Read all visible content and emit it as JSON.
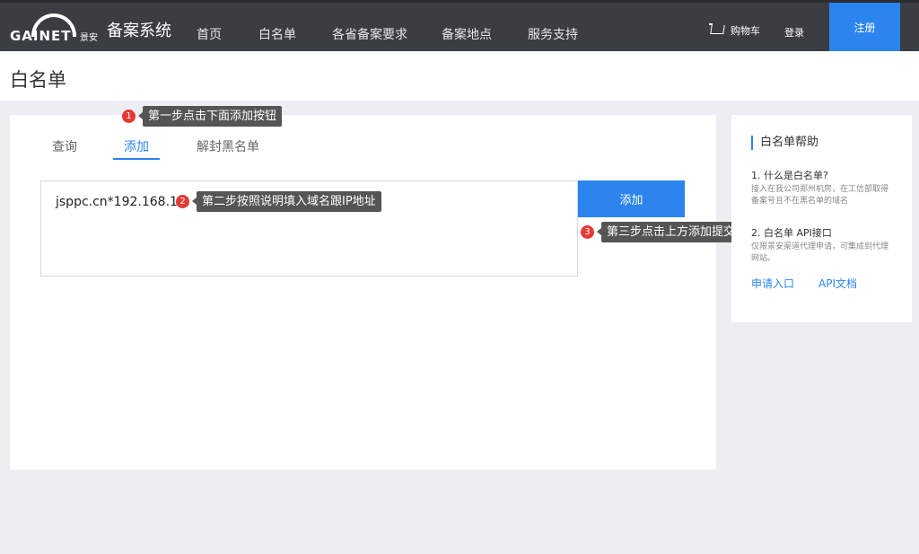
{
  "header": {
    "logo_text": "GAINET",
    "logo_sub": "景安",
    "system_title": "备案系统",
    "nav": [
      "首页",
      "白名单",
      "各省备案要求",
      "备案地点",
      "服务支持"
    ],
    "cart_label": "购物车",
    "login_label": "登录",
    "register_label": "注册"
  },
  "page": {
    "title": "白名单"
  },
  "tabs": [
    "查询",
    "添加",
    "解封黑名单"
  ],
  "form": {
    "input_value": "jsppc.cn*192.168.1.1",
    "add_button": "添加"
  },
  "steps": [
    {
      "num": "1",
      "text": "第一步点击下面添加按钮"
    },
    {
      "num": "2",
      "text": "第二步按照说明填入域名跟IP地址"
    },
    {
      "num": "3",
      "text": "第三步点击上方添加提交"
    }
  ],
  "sidebar": {
    "title": "白名单帮助",
    "q1": "1. 什么是白名单?",
    "q1_desc": "接入在我公司郑州机房，在工信部取得备案号且不在黑名单的域名",
    "q2": "2. 白名单 API接口",
    "q2_desc": "仅限景安渠道代理申请，可集成到代理网站。",
    "link_apply": "申请入口",
    "link_api": "API文档"
  },
  "colors": {
    "accent": "#2c84ee",
    "topbar": "#3a3d42",
    "step_badge": "#e53935"
  }
}
